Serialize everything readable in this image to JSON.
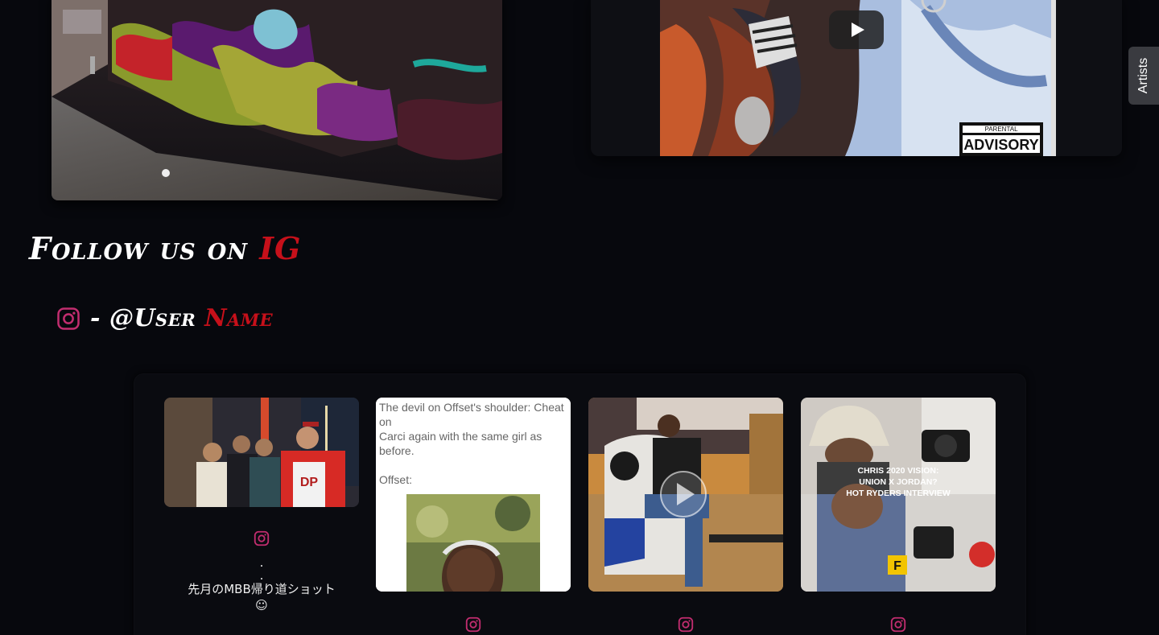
{
  "side_tab": {
    "label": "Artists"
  },
  "follow_section": {
    "heading_prefix": "Follow us on ",
    "heading_accent": "IG",
    "handle_prefix": " - @User ",
    "handle_accent": "Name",
    "icon": "instagram-icon"
  },
  "video": {
    "play_icon": "play-icon"
  },
  "colors": {
    "accent": "#c6101a",
    "instagram_pink": "#c22d6f",
    "background": "#07080d"
  },
  "posts": [
    {
      "caption_lines": [
        ".",
        ".",
        "先月のMBB帰り道ショット",
        "☺"
      ]
    },
    {
      "meme_line1": "The devil on Offset's shoulder: Cheat on",
      "meme_line2": "Carci again with the same girl as before.",
      "meme_line3": "Offset:"
    },
    {
      "caption_lines": []
    },
    {
      "overlay_line1": "CHRIS 2020 VISION:",
      "overlay_line2": "UNION X JORDAN?",
      "overlay_line3": "HOT RYDERS INTERVIEW"
    }
  ]
}
